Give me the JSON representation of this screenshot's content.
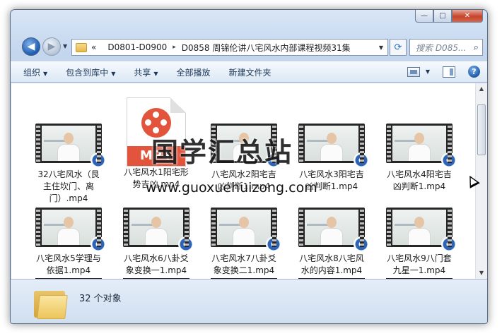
{
  "window": {
    "caption_buttons": {
      "minimize": "—",
      "maximize": "□",
      "close": "✕"
    }
  },
  "nav": {
    "back_glyph": "◀",
    "forward_glyph": "▶",
    "dropdown_glyph": "▼"
  },
  "address": {
    "prefix": "«",
    "crumbs": [
      "D0801-D0900",
      "D0858 周锦伦讲八宅风水内部课程视频31集"
    ],
    "separator": "▸",
    "dropdown_glyph": "▼",
    "refresh_glyph": "⟳"
  },
  "search": {
    "placeholder": "搜索 D085...",
    "icon": "search-icon"
  },
  "toolbar": {
    "organize": "组织",
    "include_library": "包含到库中",
    "share": "共享",
    "play_all": "全部播放",
    "new_folder": "新建文件夹",
    "dropdown_glyph": "▼",
    "help": "?"
  },
  "files": [
    {
      "name": "32八宅风水（艮主住坎门、离门）.mp4"
    },
    {
      "name": "八宅风水1阳宅形势吉凶.mp4",
      "generic_icon_text": "MP4"
    },
    {
      "name": "八宅风水2阳宅吉凶判断1.mp4"
    },
    {
      "name": "八宅风水3阳宅吉凶判断1.mp4"
    },
    {
      "name": "八宅风水4阳宅吉凶判断1.mp4"
    },
    {
      "name": "八宅风水5学理与依据1.mp4"
    },
    {
      "name": "八宅风水6八卦爻象变换一1.mp4"
    },
    {
      "name": "八宅风水7八卦爻象变换二1.mp4"
    },
    {
      "name": "八宅风水8八宅风水的内容1.mp4"
    },
    {
      "name": "八宅风水9八门套九星一1.mp4"
    }
  ],
  "details": {
    "count_text": "32 个对象"
  },
  "watermark": {
    "text": "国学汇总站",
    "url": "www.guoxuehuizong.com"
  }
}
